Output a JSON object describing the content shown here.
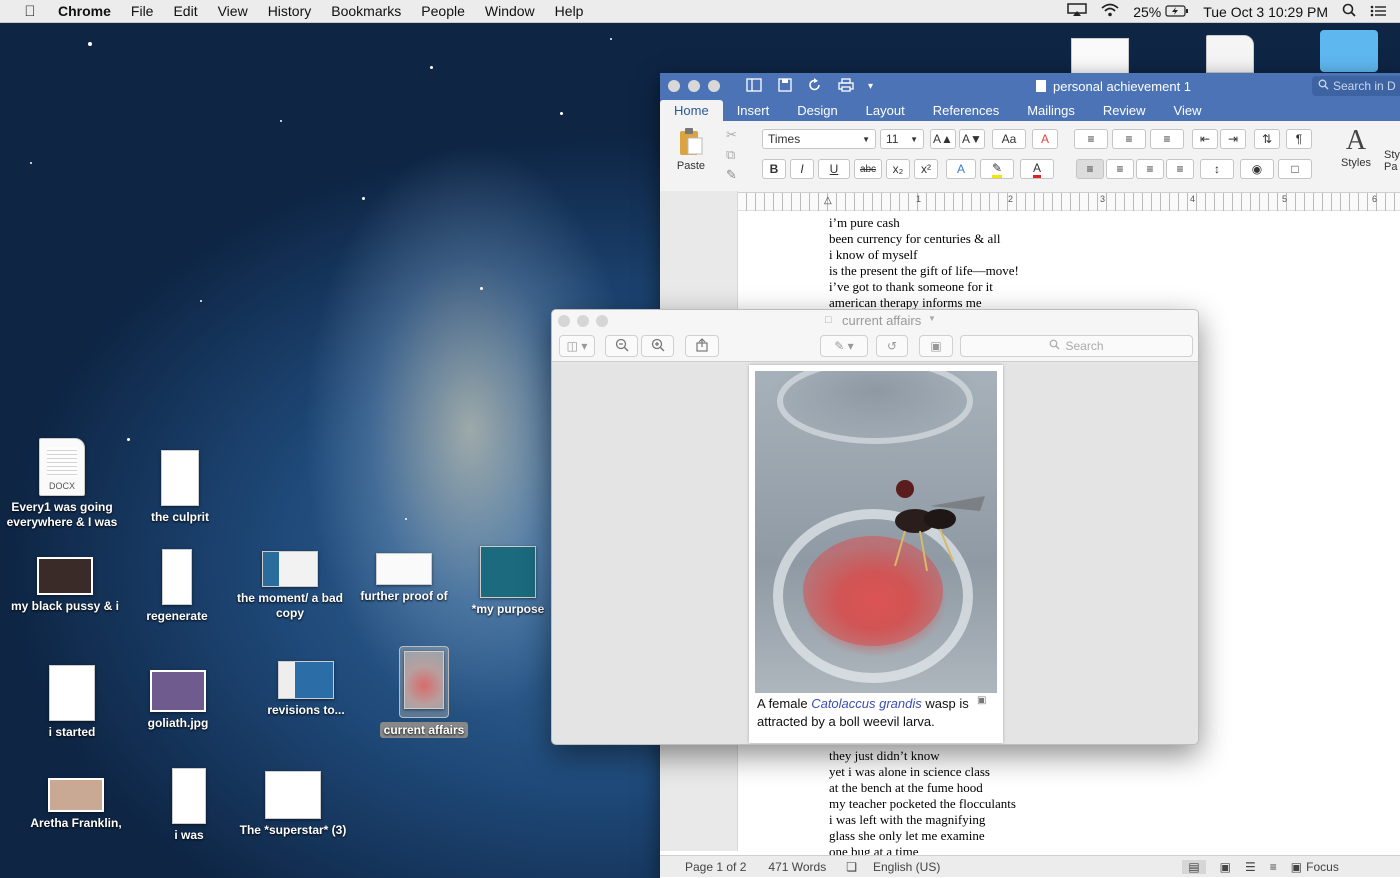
{
  "menubar": {
    "app": "Chrome",
    "items": [
      "File",
      "Edit",
      "View",
      "History",
      "Bookmarks",
      "People",
      "Window",
      "Help"
    ],
    "battery": "25%",
    "clock": "Tue Oct 3  10:29 PM"
  },
  "desktop": {
    "icons": [
      {
        "label": "Every1 was going everywhere & I was",
        "badge": "DOCX"
      },
      {
        "label": "the culprit"
      },
      {
        "label": "my black pussy & i"
      },
      {
        "label": "regenerate"
      },
      {
        "label": "the moment/ a bad copy"
      },
      {
        "label": "further proof of"
      },
      {
        "label": "*my purpose"
      },
      {
        "label": "i started"
      },
      {
        "label": "goliath.jpg"
      },
      {
        "label": "revisions to..."
      },
      {
        "label": "current affairs"
      },
      {
        "label": "Aretha Franklin,"
      },
      {
        "label": "i was"
      },
      {
        "label": "The *superstar* (3)"
      }
    ]
  },
  "word": {
    "title": "personal achievement 1",
    "search_placeholder": "Search in D",
    "tabs": [
      "Home",
      "Insert",
      "Design",
      "Layout",
      "References",
      "Mailings",
      "Review",
      "View"
    ],
    "font_name": "Times",
    "font_size": "11",
    "paste_label": "Paste",
    "styles_label": "Styles",
    "styles_pane_label": "Sty Pa",
    "ruler_numbers": [
      "1",
      "2",
      "3",
      "4",
      "5",
      "6"
    ],
    "lines_top": [
      "i’m pure cash",
      "been currency for centuries & all",
      "i know of myself",
      "is the present the gift of life—move!",
      "i’ve got to thank someone for it",
      "american therapy informs me"
    ],
    "lines_bottom": [
      "they just didn’t know",
      "yet i was alone in science class",
      "at the bench at the fume hood",
      "my teacher pocketed the flocculants",
      "i was left with the magnifying",
      "glass she only let me examine",
      "one bug at a time"
    ],
    "status": {
      "page": "Page 1 of 2",
      "words": "471 Words",
      "language": "English (US)",
      "focus": "Focus"
    }
  },
  "preview": {
    "title": "current affairs",
    "search_placeholder": "Search",
    "caption_pre": "A female ",
    "caption_link": "Catolaccus grandis",
    "caption_post": " wasp is attracted by a boll weevil larva."
  }
}
